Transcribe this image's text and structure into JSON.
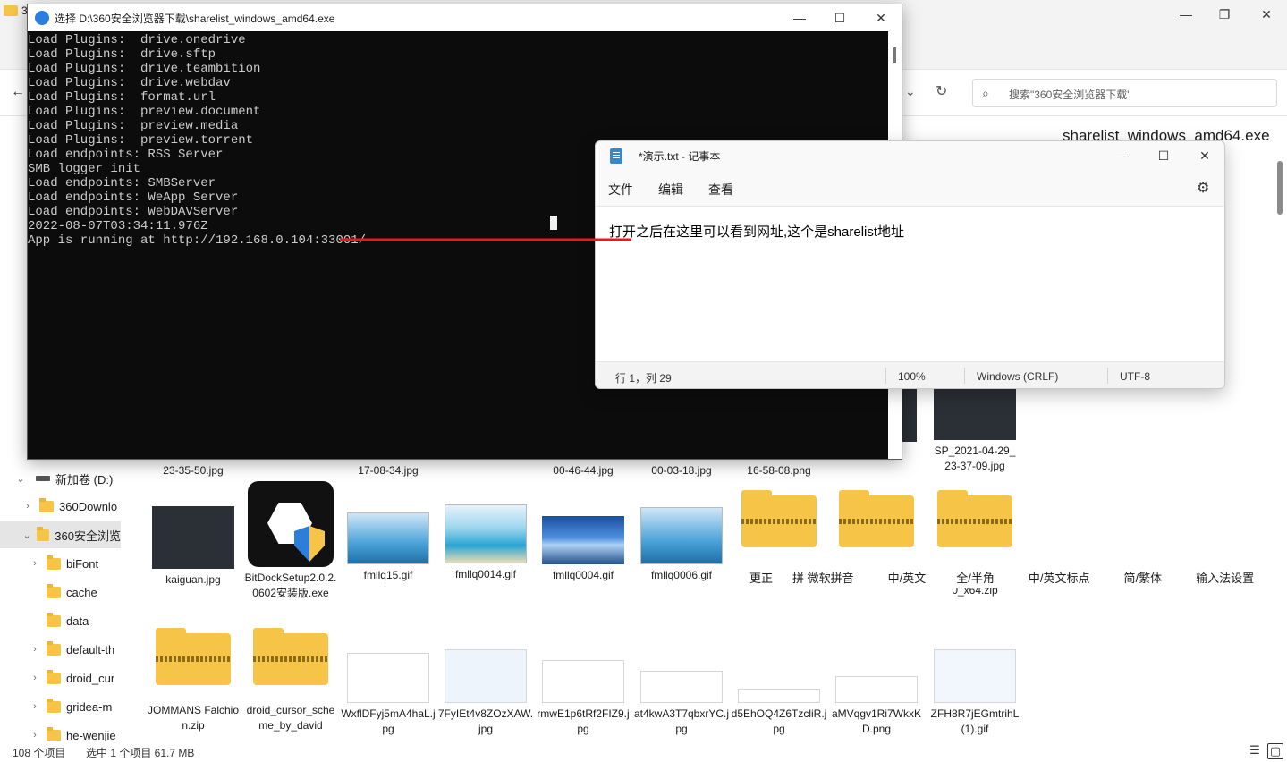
{
  "explorer": {
    "tab_label": "36",
    "search_placeholder": "搜索\"360安全浏览器下载\"",
    "window_controls": {
      "minimize": "—",
      "maximize": "❐",
      "close": "✕"
    },
    "preview_filename": "sharelist_windows_amd64.exe",
    "nav_items": [
      {
        "label": "新加卷 (D:)",
        "type": "drive",
        "expanded": true
      },
      {
        "label": "360Downlo",
        "type": "folder",
        "expanded": false
      },
      {
        "label": "360安全浏览",
        "type": "folder",
        "expanded": true,
        "selected": true
      },
      {
        "label": "biFont",
        "type": "folder",
        "expanded": false
      },
      {
        "label": "cache",
        "type": "folder",
        "expanded": null
      },
      {
        "label": "data",
        "type": "folder",
        "expanded": null
      },
      {
        "label": "default-th",
        "type": "folder",
        "expanded": false
      },
      {
        "label": "droid_cur",
        "type": "folder",
        "expanded": false
      },
      {
        "label": "gridea-m",
        "type": "folder",
        "expanded": false
      },
      {
        "label": "he-wenjie",
        "type": "folder",
        "expanded": false
      }
    ],
    "top_row_captions": [
      "23-35-50.jpg",
      "17-08-34.jpg",
      "00-46-44.jpg",
      "00-03-18.jpg",
      "16-58-08.png",
      "SP_2021-04-29_\n23-37-09.jpg"
    ],
    "files_row2": [
      {
        "name": "kaiguan.jpg",
        "thumb": "dark"
      },
      {
        "name": "BitDockSetup2.0.2.0602安装版.exe",
        "thumb": "bitdock"
      },
      {
        "name": "fmllq15.gif",
        "thumb": "blue"
      },
      {
        "name": "fmllq0014.gif",
        "thumb": "beach"
      },
      {
        "name": "fmllq0004.gif",
        "thumb": "sea"
      },
      {
        "name": "fmllq0006.gif",
        "thumb": "blue"
      },
      {
        "name": "",
        "thumb": "zip"
      },
      {
        "name": "",
        "thumb": "zip"
      },
      {
        "name": "0_x64.zip",
        "thumb": "zip"
      }
    ],
    "files_row3": [
      {
        "name": "JOMMANS Falchion.zip",
        "thumb": "zip"
      },
      {
        "name": "droid_cursor_scheme_by_david",
        "thumb": "zip"
      },
      {
        "name": "WxflDFyj5mA4haL.jpg",
        "thumb": "doc"
      },
      {
        "name": "7FyIEt4v8ZOzXAW.jpg",
        "thumb": "doc"
      },
      {
        "name": "rmwE1p6tRf2FIZ9.jpg",
        "thumb": "doc"
      },
      {
        "name": "at4kwA3T7qbxrYC.jpg",
        "thumb": "doc"
      },
      {
        "name": "d5EhOQ4Z6TzcliR.jpg",
        "thumb": "doc"
      },
      {
        "name": "aMVqgv1Ri7WkxKD.png",
        "thumb": "doc"
      },
      {
        "name": "ZFH8R7jEGmtrihL (1).gif",
        "thumb": "doc"
      }
    ],
    "ime_bar": [
      "更正",
      "拼 微软拼音",
      "中/英文",
      "全/半角",
      "中/英文标点",
      "简/繁体",
      "输入法设置"
    ],
    "status": {
      "count": "108 个项目",
      "selection": "选中 1 个项目  61.7 MB"
    }
  },
  "console": {
    "title": "选择 D:\\360安全浏览器下载\\sharelist_windows_amd64.exe",
    "lines": [
      "Load Plugins:  drive.onedrive",
      "Load Plugins:  drive.sftp",
      "Load Plugins:  drive.teambition",
      "Load Plugins:  drive.webdav",
      "Load Plugins:  format.url",
      "Load Plugins:  preview.document",
      "Load Plugins:  preview.media",
      "Load Plugins:  preview.torrent",
      "Load endpoints: RSS Server",
      "SMB logger init",
      "Load endpoints: SMBServer",
      "Load endpoints: WeApp Server",
      "Load endpoints: WebDAVServer",
      "2022-08-07T03:34:11.976Z",
      "App is running at http://192.168.0.104:33001/"
    ]
  },
  "notepad": {
    "title": "*演示.txt - 记事本",
    "menu": [
      "文件",
      "编辑",
      "查看"
    ],
    "content": "打开之后在这里可以看到网址,这个是sharelist地址",
    "status": {
      "position": "行 1，列 29",
      "zoom": "100%",
      "eol": "Windows (CRLF)",
      "encoding": "UTF-8"
    }
  },
  "colors": {
    "annotation": "#e01e1e",
    "console_bg": "#0c0c0c",
    "folder": "#f6c548"
  }
}
